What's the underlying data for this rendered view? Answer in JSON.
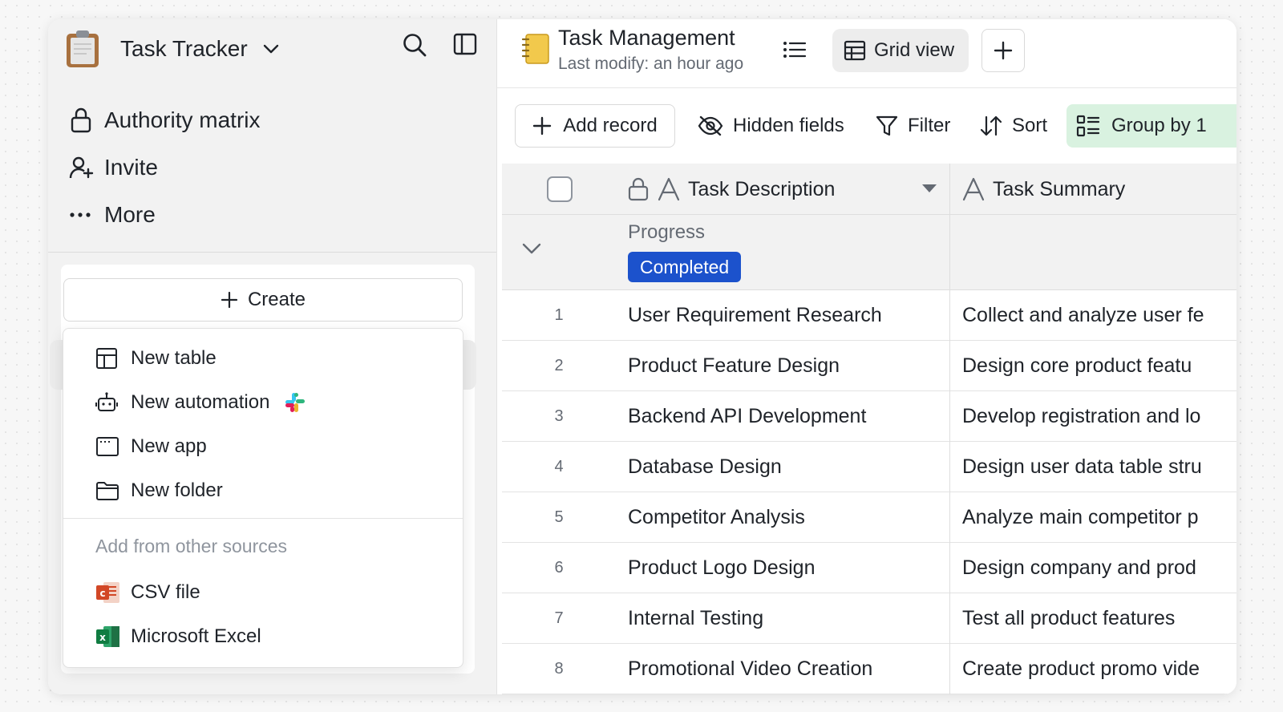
{
  "sidebar": {
    "app_title": "Task Tracker",
    "menu": [
      {
        "label": "Authority matrix",
        "icon": "lock-icon"
      },
      {
        "label": "Invite",
        "icon": "add-user-icon"
      },
      {
        "label": "More",
        "icon": "more-dots-icon"
      }
    ],
    "create_label": "Create",
    "create_menu": {
      "items": [
        {
          "label": "New table",
          "icon": "table-icon"
        },
        {
          "label": "New automation",
          "icon": "robot-icon"
        },
        {
          "label": "New app",
          "icon": "app-window-icon"
        },
        {
          "label": "New folder",
          "icon": "folder-icon"
        }
      ],
      "section_label": "Add from other sources",
      "sources": [
        {
          "label": "CSV file",
          "icon": "csv-file-icon"
        },
        {
          "label": "Microsoft Excel",
          "icon": "excel-icon"
        }
      ]
    }
  },
  "topbar": {
    "title": "Task Management",
    "subtitle": "Last modify: an hour ago",
    "view_label": "Grid view"
  },
  "toolbar": {
    "add_record": "Add record",
    "hidden_fields": "Hidden fields",
    "filter": "Filter",
    "sort": "Sort",
    "group_by": "Group by 1"
  },
  "grid": {
    "columns": [
      {
        "label": "Task Description"
      },
      {
        "label": "Task Summary"
      }
    ],
    "group": {
      "field": "Progress",
      "value": "Completed"
    },
    "rows": [
      {
        "num": "1",
        "desc": "User Requirement Research",
        "summary": "Collect and analyze user fe"
      },
      {
        "num": "2",
        "desc": "Product Feature Design",
        "summary": "Design core product featu"
      },
      {
        "num": "3",
        "desc": "Backend API Development",
        "summary": "Develop registration and lo"
      },
      {
        "num": "4",
        "desc": "Database Design",
        "summary": "Design user data table stru"
      },
      {
        "num": "5",
        "desc": "Competitor Analysis",
        "summary": "Analyze main competitor p"
      },
      {
        "num": "6",
        "desc": "Product Logo Design",
        "summary": "Design company and prod"
      },
      {
        "num": "7",
        "desc": "Internal Testing",
        "summary": "Test all product features"
      },
      {
        "num": "8",
        "desc": "Promotional Video Creation",
        "summary": "Create product promo vide"
      }
    ]
  },
  "colors": {
    "accent_badge": "#1c52cc",
    "group_by_bg": "#d9f2e0",
    "sidebar_bg": "#f2f2f2"
  }
}
